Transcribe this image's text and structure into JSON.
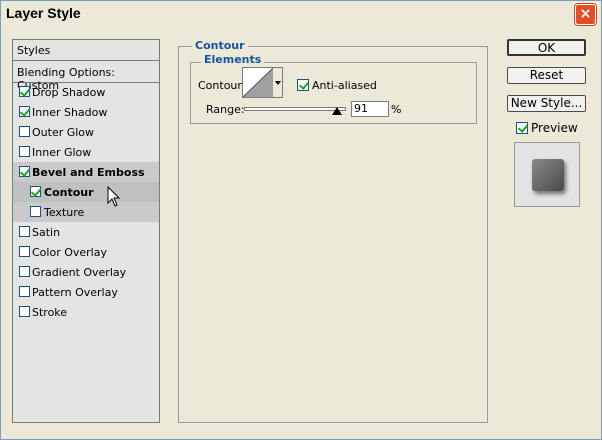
{
  "window": {
    "title": "Layer Style",
    "close": "×"
  },
  "styles_panel": {
    "header": "Styles",
    "blending": "Blending Options: Custom",
    "items": [
      {
        "label": "Drop Shadow",
        "checked": true
      },
      {
        "label": "Inner Shadow",
        "checked": true
      },
      {
        "label": "Outer Glow",
        "checked": false
      },
      {
        "label": "Inner Glow",
        "checked": false
      },
      {
        "label": "Bevel and Emboss",
        "checked": true
      },
      {
        "label": "Contour",
        "checked": true
      },
      {
        "label": "Texture",
        "checked": false
      },
      {
        "label": "Satin",
        "checked": false
      },
      {
        "label": "Color Overlay",
        "checked": false
      },
      {
        "label": "Gradient Overlay",
        "checked": false
      },
      {
        "label": "Pattern Overlay",
        "checked": false
      },
      {
        "label": "Stroke",
        "checked": false
      }
    ]
  },
  "contour_group": {
    "title": "Contour",
    "elements_title": "Elements",
    "contour_label": "Contour:",
    "anti_aliased_label": "Anti-aliased",
    "anti_aliased": true,
    "range_label": "Range:",
    "range_value": "91",
    "range_percent": 91,
    "pct_sign": "%"
  },
  "buttons": {
    "ok": "OK",
    "reset": "Reset",
    "new_style": "New Style..."
  },
  "preview": {
    "label": "Preview",
    "checked": true
  }
}
